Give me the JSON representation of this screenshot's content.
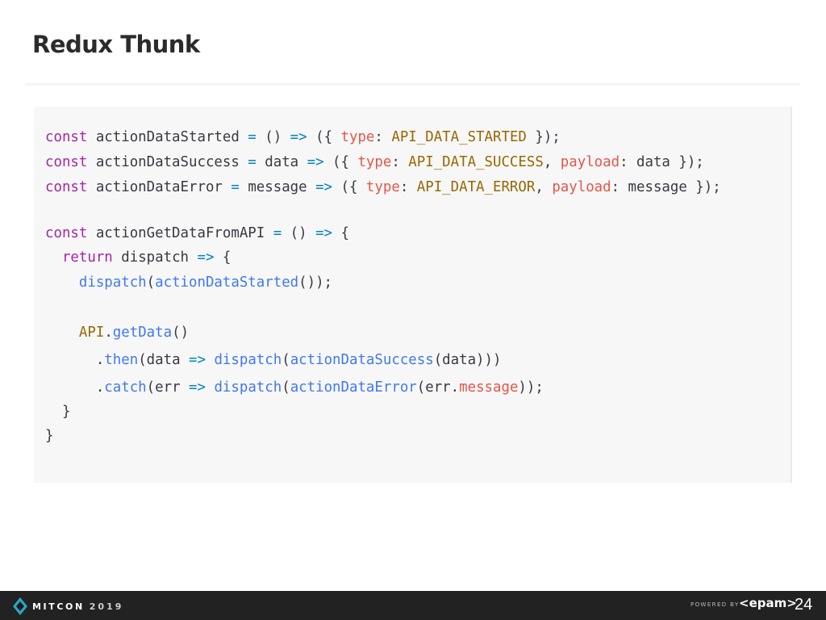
{
  "slide": {
    "title": "Redux Thunk",
    "page_number": "24"
  },
  "footer": {
    "conference": "MITCON",
    "year": "2019",
    "powered_by": "POWERED BY",
    "brand": "<epam>"
  },
  "colors": {
    "keyword": "#a626a4",
    "function": "#4078f2",
    "property": "#e45649",
    "constant": "#986801",
    "operator": "#0184bc",
    "text": "#383a42",
    "code_background": "#f7f7f7",
    "footer_background": "#222222"
  },
  "code": {
    "language": "javascript",
    "lines": [
      [
        [
          "kw",
          "const"
        ],
        [
          "p",
          " actionDataStarted "
        ],
        [
          "op",
          "="
        ],
        [
          "p",
          " () "
        ],
        [
          "op",
          "=>"
        ],
        [
          "p",
          " ({ "
        ],
        [
          "prop",
          "type"
        ],
        [
          "p",
          ": "
        ],
        [
          "const",
          "API_DATA_STARTED"
        ],
        [
          "p",
          " });"
        ]
      ],
      [
        [
          "kw",
          "const"
        ],
        [
          "p",
          " actionDataSuccess "
        ],
        [
          "op",
          "="
        ],
        [
          "p",
          " data "
        ],
        [
          "op",
          "=>"
        ],
        [
          "p",
          " ({ "
        ],
        [
          "prop",
          "type"
        ],
        [
          "p",
          ": "
        ],
        [
          "const",
          "API_DATA_SUCCESS"
        ],
        [
          "p",
          ", "
        ],
        [
          "prop",
          "payload"
        ],
        [
          "p",
          ": data });"
        ]
      ],
      [
        [
          "kw",
          "const"
        ],
        [
          "p",
          " actionDataError "
        ],
        [
          "op",
          "="
        ],
        [
          "p",
          " message "
        ],
        [
          "op",
          "=>"
        ],
        [
          "p",
          " ({ "
        ],
        [
          "prop",
          "type"
        ],
        [
          "p",
          ": "
        ],
        [
          "const",
          "API_DATA_ERROR"
        ],
        [
          "p",
          ", "
        ],
        [
          "prop",
          "payload"
        ],
        [
          "p",
          ": message });"
        ]
      ],
      [],
      [
        [
          "kw",
          "const"
        ],
        [
          "p",
          " actionGetDataFromAPI "
        ],
        [
          "op",
          "="
        ],
        [
          "p",
          " () "
        ],
        [
          "op",
          "=>"
        ],
        [
          "p",
          " {"
        ]
      ],
      [
        [
          "p",
          "  "
        ],
        [
          "kw",
          "return"
        ],
        [
          "p",
          " dispatch "
        ],
        [
          "op",
          "=>"
        ],
        [
          "p",
          " {"
        ]
      ],
      [
        [
          "p",
          "    "
        ],
        [
          "fn",
          "dispatch"
        ],
        [
          "p",
          "("
        ],
        [
          "fn",
          "actionDataStarted"
        ],
        [
          "p",
          "());"
        ]
      ],
      [],
      [
        [
          "p",
          "    "
        ],
        [
          "const",
          "API"
        ],
        [
          "p",
          "."
        ],
        [
          "fn",
          "getData"
        ],
        [
          "p",
          "()"
        ]
      ],
      [
        [
          "p",
          "      ."
        ],
        [
          "fn",
          "then"
        ],
        [
          "p",
          "(data "
        ],
        [
          "op",
          "=>"
        ],
        [
          "p",
          " "
        ],
        [
          "fn",
          "dispatch"
        ],
        [
          "p",
          "("
        ],
        [
          "fn",
          "actionDataSuccess"
        ],
        [
          "p",
          "(data)))"
        ]
      ],
      [
        [
          "p",
          "      ."
        ],
        [
          "fn",
          "catch"
        ],
        [
          "p",
          "(err "
        ],
        [
          "op",
          "=>"
        ],
        [
          "p",
          " "
        ],
        [
          "fn",
          "dispatch"
        ],
        [
          "p",
          "("
        ],
        [
          "fn",
          "actionDataError"
        ],
        [
          "p",
          "(err."
        ],
        [
          "prop",
          "message"
        ],
        [
          "p",
          "));"
        ]
      ],
      [
        [
          "p",
          "  }"
        ]
      ],
      [
        [
          "p",
          "}"
        ]
      ]
    ]
  }
}
